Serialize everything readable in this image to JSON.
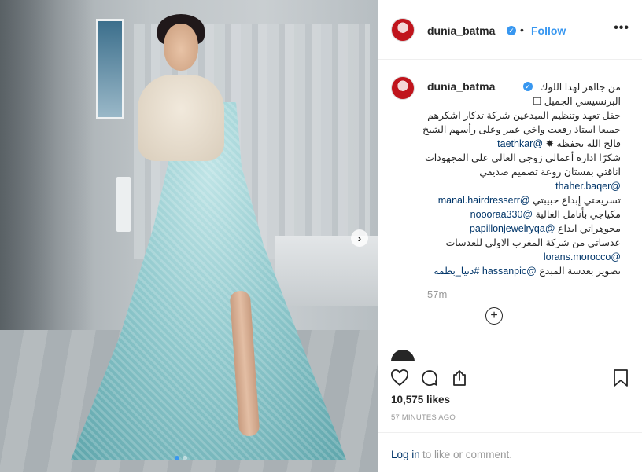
{
  "post": {
    "username": "dunia_batma",
    "separator": "•",
    "follow_label": "Follow",
    "more_icon": "more-horizontal-icon",
    "verified_icon": "verified-badge-icon"
  },
  "photo": {
    "next_icon": "chevron-right-icon",
    "next_glyph": "›",
    "carousel_count": 2
  },
  "caption": {
    "username": "dunia_batma",
    "lines": [
      {
        "text": "من جااهز لهدا اللوك",
        "mention": ""
      },
      {
        "text": "البرنسيسي الجميل ☐",
        "mention": ""
      },
      {
        "text": "حفل تعهد وتنظيم المبدعين شركة تذكار اشكرهم",
        "mention": ""
      },
      {
        "text": "جميعا استاذ رفعت واخي عمر وعلى رأسهم الشيخ",
        "mention": ""
      },
      {
        "text": "فالح الله يحفظه ✹ ",
        "mention": "@taethkar"
      },
      {
        "text": "شكرًا ادارة أعمالي زوجي الغالي على المجهودات",
        "mention": ""
      },
      {
        "text": "اناقتي بفستان روعة تصميم صديقي",
        "mention": ""
      },
      {
        "text": "",
        "mention": "@thaher.baqer"
      },
      {
        "text": "تسريحتي إبداع حبيبتي ",
        "mention": "@manal.hairdresserr"
      },
      {
        "text": "مكياجي بأنامل الغالية ",
        "mention": "@noooraa330"
      },
      {
        "text": "مجوهراتي ابداع ",
        "mention": "@papillonjewelryqa"
      },
      {
        "text": "عدساتي من شركة المغرب الاولى للعدسات",
        "mention": ""
      },
      {
        "text": "",
        "mention": "@lorans.morocco"
      },
      {
        "text": "تصوير بعدسة المبدع ",
        "mention": "@hassanpic",
        "hashtag": "#دنيا_بطمه"
      }
    ],
    "time_ago": "57m",
    "load_more_glyph": "+"
  },
  "actions": {
    "like_icon": "heart-icon",
    "comment_icon": "comment-icon",
    "share_icon": "share-icon",
    "save_icon": "bookmark-icon",
    "likes": "10,575 likes",
    "timestamp": "57 MINUTES AGO",
    "login_link": "Log in",
    "login_rest": "to like or comment."
  },
  "colors": {
    "link": "#003569",
    "accent": "#3897f0",
    "muted": "#999999",
    "text": "#262626"
  }
}
